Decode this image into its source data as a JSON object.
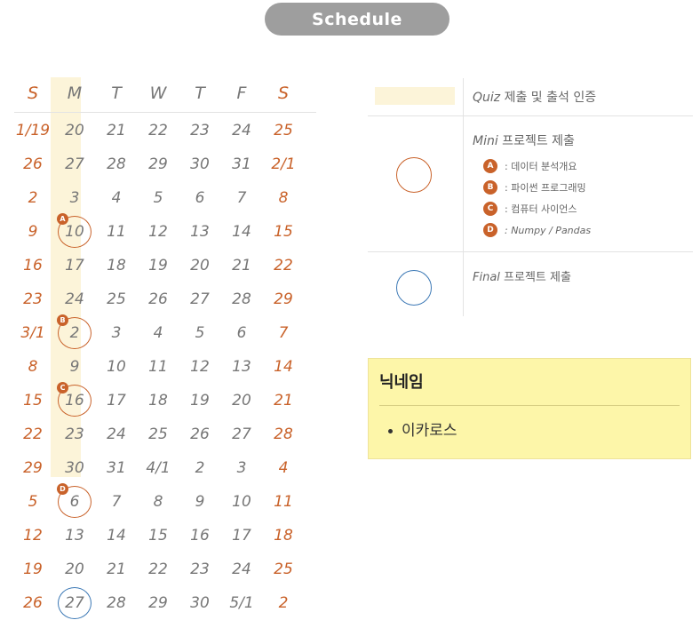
{
  "title": "Schedule",
  "weekdays": [
    "S",
    "M",
    "T",
    "W",
    "T",
    "F",
    "S"
  ],
  "weeks": [
    [
      "1/19",
      "20",
      "21",
      "22",
      "23",
      "24",
      "25"
    ],
    [
      "26",
      "27",
      "28",
      "29",
      "30",
      "31",
      "2/1"
    ],
    [
      "2",
      "3",
      "4",
      "5",
      "6",
      "7",
      "8"
    ],
    [
      "9",
      "10",
      "11",
      "12",
      "13",
      "14",
      "15"
    ],
    [
      "16",
      "17",
      "18",
      "19",
      "20",
      "21",
      "22"
    ],
    [
      "23",
      "24",
      "25",
      "26",
      "27",
      "28",
      "29"
    ],
    [
      "3/1",
      "2",
      "3",
      "4",
      "5",
      "6",
      "7"
    ],
    [
      "8",
      "9",
      "10",
      "11",
      "12",
      "13",
      "14"
    ],
    [
      "15",
      "16",
      "17",
      "18",
      "19",
      "20",
      "21"
    ],
    [
      "22",
      "23",
      "24",
      "25",
      "26",
      "27",
      "28"
    ],
    [
      "29",
      "30",
      "31",
      "4/1",
      "2",
      "3",
      "4"
    ],
    [
      "5",
      "6",
      "7",
      "8",
      "9",
      "10",
      "11"
    ],
    [
      "12",
      "13",
      "14",
      "15",
      "16",
      "17",
      "18"
    ],
    [
      "19",
      "20",
      "21",
      "22",
      "23",
      "24",
      "25"
    ],
    [
      "26",
      "27",
      "28",
      "29",
      "30",
      "5/1",
      "2"
    ]
  ],
  "mini_markers": [
    {
      "week": 3,
      "badge": "A"
    },
    {
      "week": 6,
      "badge": "B"
    },
    {
      "week": 8,
      "badge": "C"
    },
    {
      "week": 11,
      "badge": "D"
    }
  ],
  "final_marker": {
    "week": 14
  },
  "legend": {
    "quiz": {
      "en": "Quiz",
      "ko": " 제출 및 출석 인증"
    },
    "mini": {
      "en": "Mini",
      "ko": " 프로젝트 제출"
    },
    "mini_items": [
      {
        "badge": "A",
        "text": ": 데이터 분석개요"
      },
      {
        "badge": "B",
        "text": ": 파이썬 프로그래밍"
      },
      {
        "badge": "C",
        "text": ": 컴퓨터 사이언스"
      },
      {
        "badge": "D",
        "text": ": Numpy / Pandas"
      }
    ],
    "final": {
      "en": "Final",
      "ko": " 프로젝트 제출"
    }
  },
  "nickname": {
    "heading": "닉네임",
    "value": "이카로스"
  },
  "colors": {
    "accent": "#c9622a",
    "blue": "#3b78b5",
    "highlight": "#fcf4d9"
  }
}
